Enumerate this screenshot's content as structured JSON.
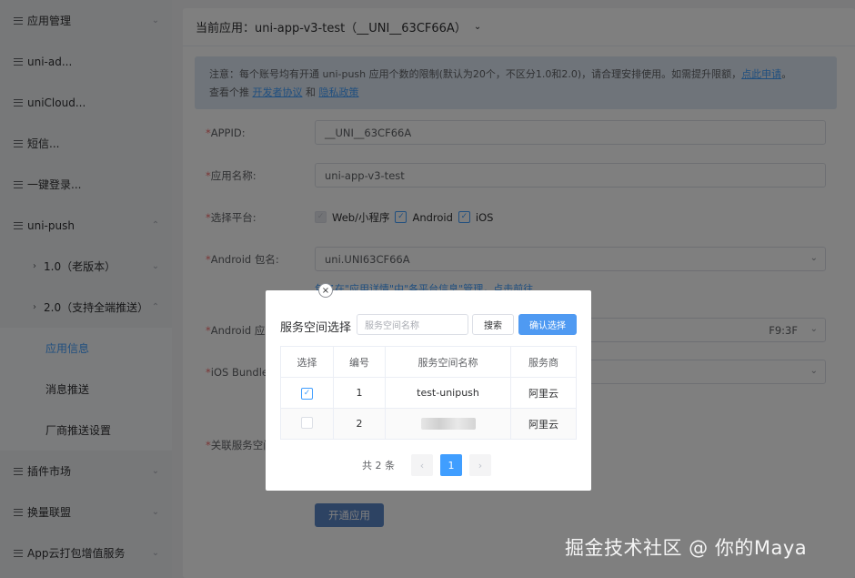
{
  "sidebar": {
    "items": [
      {
        "label": "应用管理",
        "chev": "⌄"
      },
      {
        "label": "uni-ad...",
        "chev": ""
      },
      {
        "label": "uniCloud...",
        "chev": ""
      },
      {
        "label": "短信...",
        "chev": ""
      },
      {
        "label": "一键登录...",
        "chev": ""
      },
      {
        "label": "uni-push",
        "chev": "⌃"
      },
      {
        "label": "1.0（老版本）",
        "chev": "⌄"
      },
      {
        "label": "2.0（支持全端推送）",
        "chev": "⌃"
      },
      {
        "label": "应用信息"
      },
      {
        "label": "消息推送"
      },
      {
        "label": "厂商推送设置"
      },
      {
        "label": "插件市场",
        "chev": "⌄"
      },
      {
        "label": "换量联盟",
        "chev": "⌄"
      },
      {
        "label": "App云打包增值服务",
        "chev": "⌄"
      }
    ]
  },
  "header": {
    "current_app": "当前应用：uni-app-v3-test（__UNI__63CF66A）"
  },
  "notice": {
    "line1": "注意：每个账号均有开通 uni-push 应用个数的限制(默认为20个，不区分1.0和2.0)，请合理安排使用。如需提升限额，",
    "apply_link": "点此申请",
    "line1_end": "。",
    "line2_prefix": "查看个推 ",
    "dev_agreement": "开发者协议",
    "and": " 和 ",
    "privacy": "隐私政策"
  },
  "form": {
    "appid_label": "APPID:",
    "appid_value": "__UNI__63CF66A",
    "name_label": "应用名称:",
    "name_value": "uni-app-v3-test",
    "platform_label": "选择平台:",
    "platforms": [
      "Web/小程序",
      "Android",
      "iOS"
    ],
    "android_pkg_label": "Android 包名:",
    "android_pkg_value": "uni.UNI63CF66A",
    "pkg_hint": "包名在\"应用详情\"中\"各平台信息\"管理，点击前往",
    "android_sign_label": "Android 应用",
    "android_sign_value_tail": "F9:3F",
    "ios_bundle_label": "iOS Bundle",
    "service_label": "关联服务空间",
    "open_button": "开通应用"
  },
  "modal": {
    "title": "服务空间选择",
    "search_placeholder": "服务空间名称",
    "search_button": "搜索",
    "confirm_button": "确认选择",
    "close": "×",
    "columns": [
      "选择",
      "编号",
      "服务空间名称",
      "服务商"
    ],
    "rows": [
      {
        "no": "1",
        "name": "test-unipush",
        "provider": "阿里云",
        "checked": true
      },
      {
        "no": "2",
        "name": "",
        "provider": "阿里云",
        "checked": false
      }
    ],
    "pager": {
      "total": "共 2 条",
      "prev": "‹",
      "page": "1",
      "next": "›"
    }
  },
  "watermark": "掘金技术社区 @ 你的Maya",
  "colors": {
    "primary": "#409eff",
    "required": "#f56c6c",
    "open_button": "#5b86c7"
  }
}
